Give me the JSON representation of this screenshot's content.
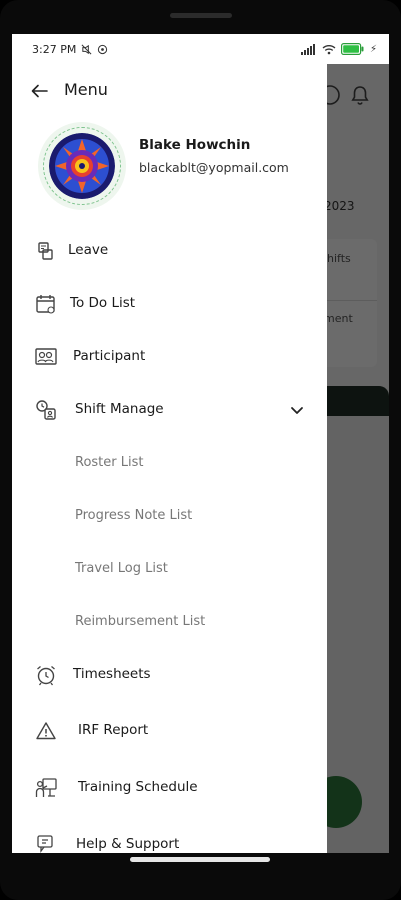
{
  "status_bar": {
    "time": "3:27 PM",
    "battery": ""
  },
  "drawer": {
    "title": "Menu",
    "user": {
      "name": "Blake Howchin",
      "email": "blackablt@yopmail.com"
    },
    "items": [
      {
        "label": "Leave",
        "icon": "leave-icon"
      },
      {
        "label": "To Do List",
        "icon": "calendar-icon"
      },
      {
        "label": "Participant",
        "icon": "participant-icon"
      },
      {
        "label": "Shift Manage",
        "icon": "shift-manage-icon",
        "expanded": true,
        "children": [
          "Roster List",
          "Progress Note List",
          "Travel Log List",
          "Reimbursement List"
        ]
      },
      {
        "label": "Timesheets",
        "icon": "alarm-clock-icon"
      },
      {
        "label": "IRF Report",
        "icon": "warning-icon"
      },
      {
        "label": "Training Schedule",
        "icon": "training-icon"
      },
      {
        "label": "Help & Support",
        "icon": "help-icon"
      }
    ]
  },
  "background": {
    "date_fragment": "2023",
    "card_text_1": "hifts",
    "card_text_2": "ment"
  },
  "colors": {
    "accent": "#2f7a3c",
    "drawer_bg": "#ffffff",
    "dark_bar": "#1f2e27"
  }
}
